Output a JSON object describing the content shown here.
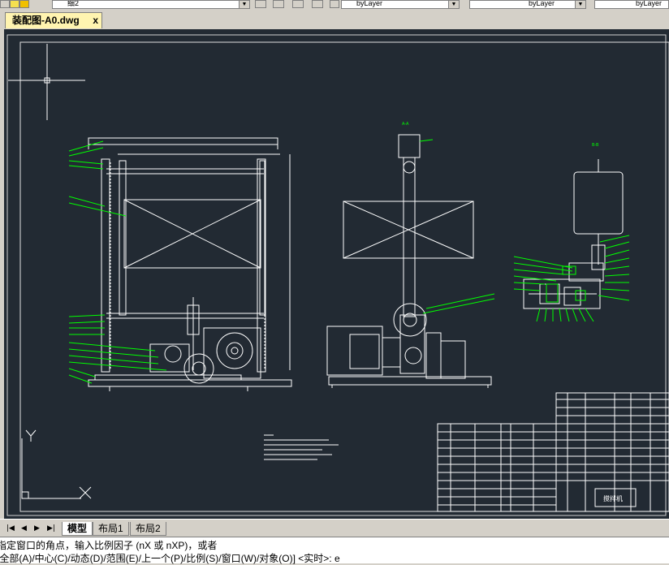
{
  "toolbar": {
    "layer_value": "细2",
    "linetype_value": "byLayer",
    "lineweight_value": "byLayer",
    "color_value": "byLayer"
  },
  "document_tab": {
    "title": "装配图-A0.dwg",
    "close_glyph": "x"
  },
  "layout_tabs": [
    "模型",
    "布局1",
    "布局2"
  ],
  "command_line": {
    "line1": "指定窗口的角点，输入比例因子 (nX 或 nXP)，或者",
    "line2": "[全部(A)/中心(C)/动态(D)/范围(E)/上一个(P)/比例(S)/窗口(W)/对象(O)] <实时>:  e"
  },
  "drawing": {
    "view_label_1": "A-A",
    "view_label_2": "B-B",
    "title_block_name": "搅拌机",
    "colors": {
      "background": "#222a33",
      "white_lines": "#ffffff",
      "leaders": "#00ff00",
      "frame": "#e0e0e0"
    }
  }
}
